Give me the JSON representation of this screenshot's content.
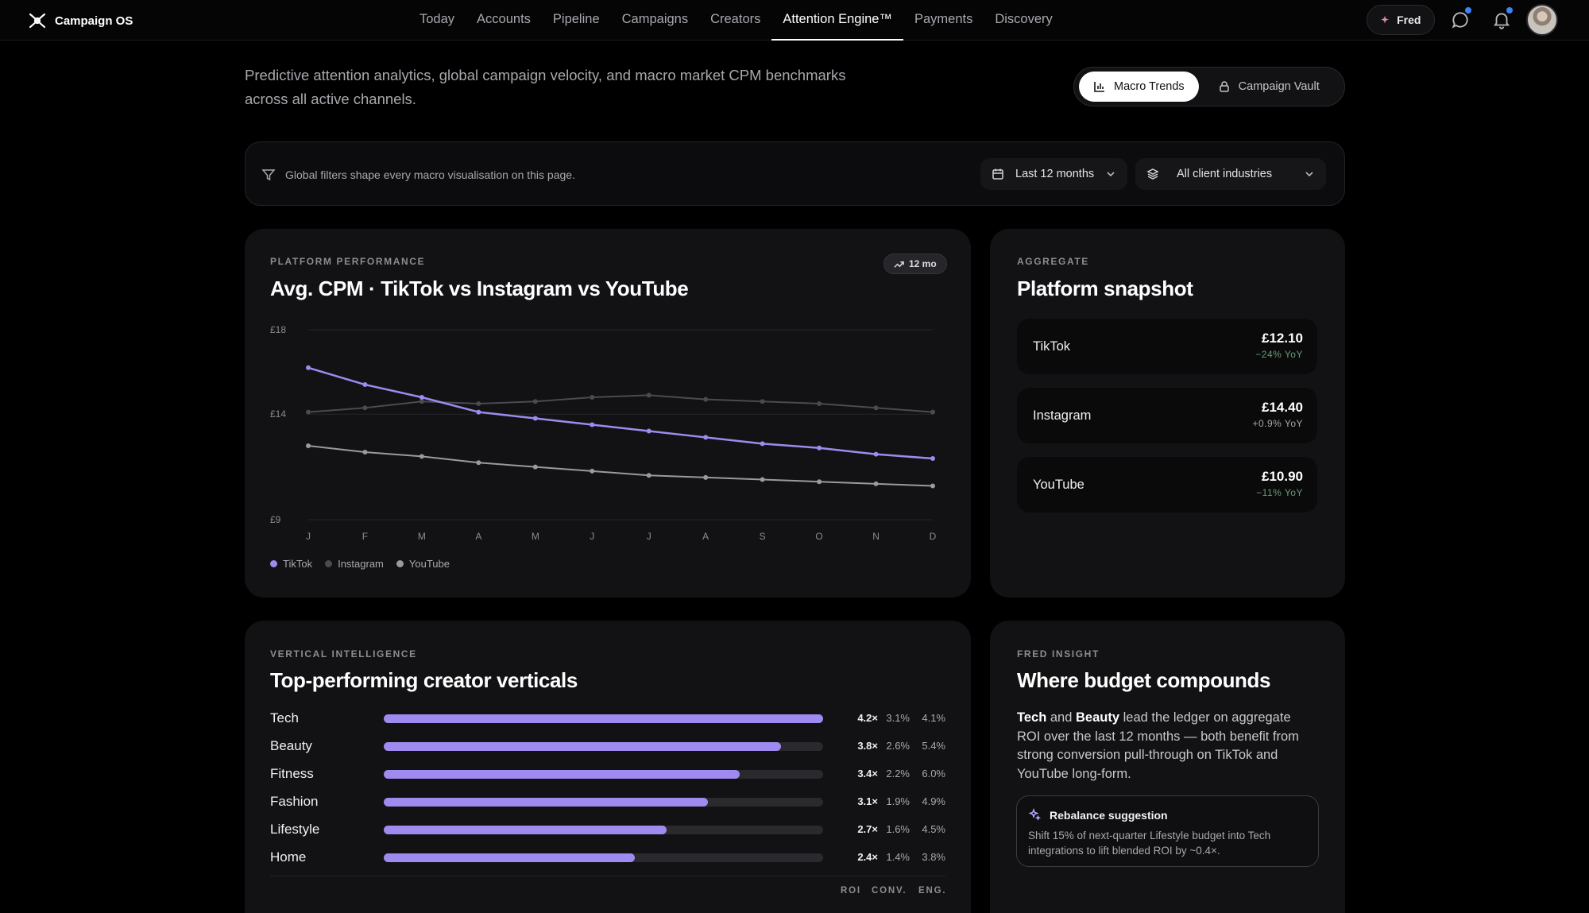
{
  "brand": {
    "name": "Campaign OS"
  },
  "nav": [
    "Today",
    "Accounts",
    "Pipeline",
    "Campaigns",
    "Creators",
    "Attention Engine™",
    "Payments",
    "Discovery"
  ],
  "nav_active": "Attention Engine™",
  "topbar": {
    "assistant_label": "Fred"
  },
  "intro": "Predictive attention analytics, global campaign velocity, and macro market CPM benchmarks across all active channels.",
  "view_toggle": {
    "macro": "Macro Trends",
    "vault": "Campaign Vault",
    "active": "Macro Trends"
  },
  "filters": {
    "note": "Global filters shape every macro visualisation on this page.",
    "period": "Last 12 months",
    "industry": "All client industries"
  },
  "cpm_card": {
    "eyebrow": "PLATFORM PERFORMANCE",
    "title": "Avg. CPM · TikTok vs Instagram vs YouTube",
    "badge": "12 mo"
  },
  "chart_data": {
    "type": "line",
    "categories": [
      "J",
      "F",
      "M",
      "A",
      "M",
      "J",
      "J",
      "A",
      "S",
      "O",
      "N",
      "D"
    ],
    "y_ticks": [
      "£18",
      "£14",
      "£9"
    ],
    "ylim": [
      9,
      18
    ],
    "grid": true,
    "legend": "bottom-left",
    "series": [
      {
        "name": "TikTok",
        "color": "#9f8af0",
        "values": [
          16.2,
          15.4,
          14.8,
          14.1,
          13.8,
          13.5,
          13.2,
          12.9,
          12.6,
          12.4,
          12.1,
          11.9
        ]
      },
      {
        "name": "Instagram",
        "color": "#4a4a50",
        "values": [
          14.1,
          14.3,
          14.6,
          14.5,
          14.6,
          14.8,
          14.9,
          14.7,
          14.6,
          14.5,
          14.3,
          14.1
        ]
      },
      {
        "name": "YouTube",
        "color": "#9a9a9f",
        "values": [
          12.5,
          12.2,
          12.0,
          11.7,
          11.5,
          11.3,
          11.1,
          11.0,
          10.9,
          10.8,
          10.7,
          10.6
        ]
      }
    ]
  },
  "snapshot": {
    "eyebrow": "AGGREGATE",
    "title": "Platform snapshot",
    "rows": [
      {
        "name": "TikTok",
        "value": "£12.10",
        "yoy": "−24% YoY",
        "yoy_color": "#6a9b78"
      },
      {
        "name": "Instagram",
        "value": "£14.40",
        "yoy": "+0.9% YoY",
        "yoy_color": "#a8a8ae"
      },
      {
        "name": "YouTube",
        "value": "£10.90",
        "yoy": "−11% YoY",
        "yoy_color": "#6a9b78"
      }
    ]
  },
  "verticals": {
    "eyebrow": "VERTICAL INTELLIGENCE",
    "title": "Top-performing creator verticals",
    "columns": [
      "ROI",
      "CONV.",
      "ENG."
    ],
    "rows": [
      {
        "name": "Tech",
        "share": 1.0,
        "roi": "4.2×",
        "conv": "3.1%",
        "eng": "4.1%"
      },
      {
        "name": "Beauty",
        "share": 0.905,
        "roi": "3.8×",
        "conv": "2.6%",
        "eng": "5.4%"
      },
      {
        "name": "Fitness",
        "share": 0.81,
        "roi": "3.4×",
        "conv": "2.2%",
        "eng": "6.0%"
      },
      {
        "name": "Fashion",
        "share": 0.738,
        "roi": "3.1×",
        "conv": "1.9%",
        "eng": "4.9%"
      },
      {
        "name": "Lifestyle",
        "share": 0.643,
        "roi": "2.7×",
        "conv": "1.6%",
        "eng": "4.5%"
      },
      {
        "name": "Home",
        "share": 0.571,
        "roi": "2.4×",
        "conv": "1.4%",
        "eng": "3.8%"
      }
    ]
  },
  "insight": {
    "eyebrow": "FRED INSIGHT",
    "title": "Where budget compounds",
    "lead_a": "Tech",
    "and": " and ",
    "lead_b": "Beauty",
    "body": " lead the ledger on aggregate ROI over the last 12 months — both benefit from strong conversion pull-through on TikTok and YouTube long-form.",
    "suggestion_title": "Rebalance suggestion",
    "suggestion_text": "Shift 15% of next-quarter Lifestyle budget into Tech integrations to lift blended ROI by ~0.4×."
  }
}
